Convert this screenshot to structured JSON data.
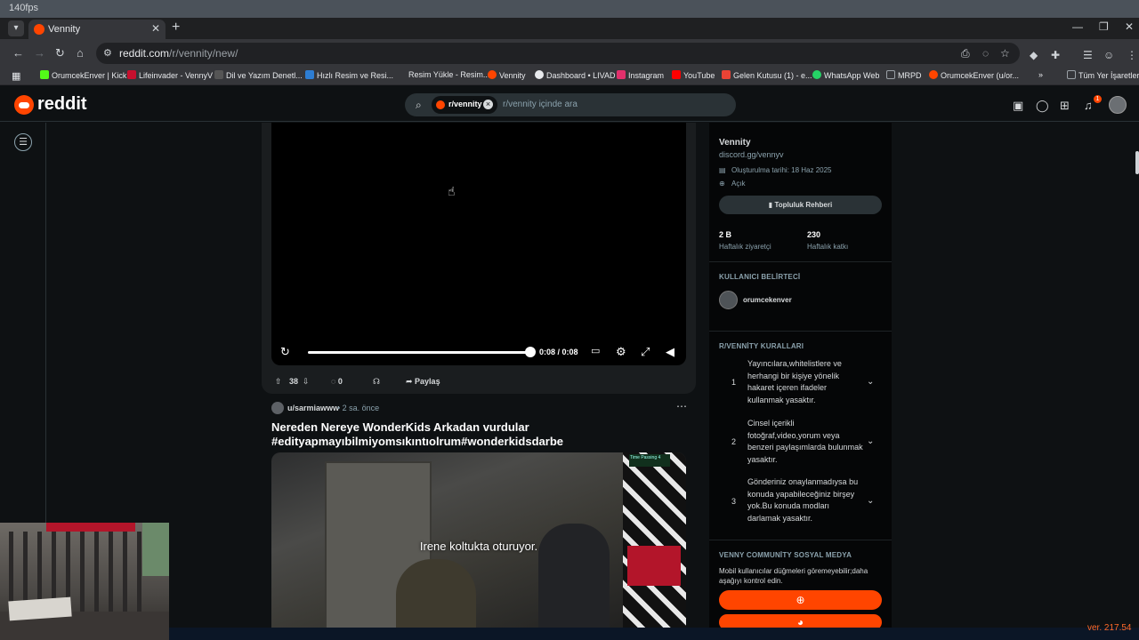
{
  "os": {
    "fps": "140fps"
  },
  "browser": {
    "tab_title": "Vennity",
    "url_host": "reddit.com",
    "url_path": "/r/vennity/new/",
    "bookmarks": [
      {
        "label": "OrumcekEnver | Kick",
        "color": "#53fc18"
      },
      {
        "label": "Lifeinvader - VennyV",
        "color": "#c8102e"
      },
      {
        "label": "Dil ve Yazım Denetl...",
        "color": "#555555"
      },
      {
        "label": "Hızlı Resim ve Resi...",
        "color": "#2d7dd2"
      },
      {
        "label": "Resim Yükle - Resim...",
        "color": "#35363a"
      },
      {
        "label": "Vennity",
        "color": "#ff4500"
      },
      {
        "label": "Dashboard • LIVAD",
        "color": "#e8eaed"
      },
      {
        "label": "Instagram",
        "color": "#e1306c"
      },
      {
        "label": "YouTube",
        "color": "#ff0000"
      },
      {
        "label": "Gelen Kutusu (1) - e...",
        "color": "#ea4335"
      },
      {
        "label": "WhatsApp Web",
        "color": "#25d366"
      },
      {
        "label": "MRPD",
        "color": "#9aa0a6"
      },
      {
        "label": "OrumcekEnver (u/or...",
        "color": "#ff4500"
      }
    ],
    "more_bookmarks": "»",
    "all_bookmarks": "Tüm Yer İşaretleri"
  },
  "reddit": {
    "logo_text": "reddit",
    "search": {
      "chip": "r/vennity",
      "placeholder": "r/vennity içinde ara"
    },
    "notif_count": "1"
  },
  "post1": {
    "time_display": "0:08 / 0:08",
    "upvotes": "38",
    "comments": "0",
    "share_label": "Paylaş"
  },
  "post2": {
    "user": "u/sarmiawww",
    "time": "• 2 sa. önce",
    "title": "Nereden Nereye WonderKids Arkadan vurdular #edityapmayıbilmiyomsıkıntıolrum#wonderkidsdarbe",
    "subtitle": "Irene koltukta oturuyor.",
    "hud": "Time Passing 4"
  },
  "sidebar": {
    "name": "Vennity",
    "desc": "discord.gg/vennyv",
    "created": "Oluşturulma tarihi: 18 Haz 2025",
    "visibility": "Açık",
    "guide_button": "Topluluk Rehberi",
    "stats": [
      {
        "value": "2 B",
        "label": "Haftalık ziyaretçi"
      },
      {
        "value": "230",
        "label": "Haftalık katkı"
      }
    ],
    "flair_heading": "KULLANICI BELİRTECİ",
    "flair_user": "orumcekenver",
    "rules_heading": "R/VENNİTY KURALLARI",
    "rules": [
      {
        "num": "1",
        "text": "Yayıncılara,whitelistlere ve herhangi bir kişiye yönelik hakaret içeren ifadeler kullanmak yasaktır."
      },
      {
        "num": "2",
        "text": "Cinsel içerikli fotoğraf,video,yorum veya benzeri paylaşımlarda bulunmak yasaktır."
      },
      {
        "num": "3",
        "text": "Gönderiniz onaylanmadıysa bu konuda yapabileceğiniz birşey yok.Bu konuda modları darlamak yasaktır."
      }
    ],
    "social_heading": "VENNY COMMUNİTY SOSYAL MEDYA",
    "social_note": "Mobil kullanıcılar düğmeleri göremeyebilir;daha aşağıyı kontrol edin."
  },
  "overlay": {
    "version": "ver. 217.54"
  },
  "colors": {
    "accent": "#ff4500",
    "bg": "#0e1113"
  }
}
